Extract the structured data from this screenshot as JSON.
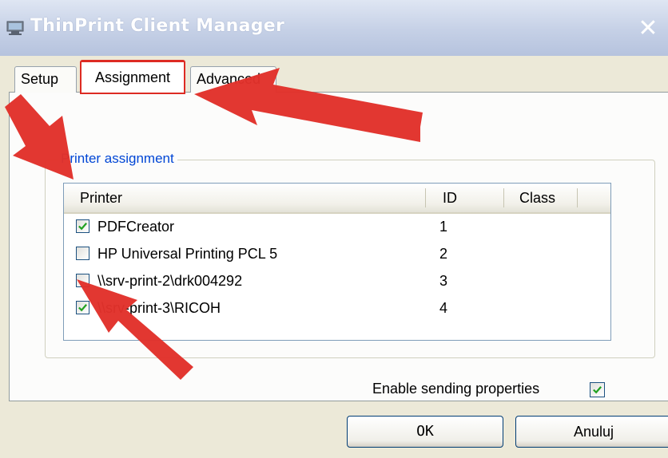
{
  "window": {
    "title": "ThinPrint Client Manager",
    "close_glyph": "✕"
  },
  "tabs": [
    {
      "label": "Setup"
    },
    {
      "label": "Assignment"
    },
    {
      "label": "Advanced"
    }
  ],
  "group": {
    "label": "Printer assignment"
  },
  "list": {
    "columns": [
      "Printer",
      "ID",
      "Class"
    ],
    "rows": [
      {
        "name": "PDFCreator",
        "id": "1",
        "checked": true
      },
      {
        "name": "HP Universal Printing PCL 5",
        "id": "2",
        "checked": false
      },
      {
        "name": "\\\\srv-print-2\\drk004292",
        "id": "3",
        "checked": false
      },
      {
        "name": "\\\\srv-print-3\\RICOH",
        "id": "4",
        "checked": true
      }
    ]
  },
  "options": {
    "enable_sending_properties_label": "Enable sending properties",
    "enable_sending_properties_checked": true
  },
  "buttons": {
    "ok_label": "OK",
    "cancel_label": "Anuluj"
  },
  "colors": {
    "highlight_red": "#dd2b23",
    "group_label_blue": "#0046d5",
    "check_green": "#21a121"
  },
  "icons": {
    "title": "printer-app-icon",
    "annotation": "red-arrow-icon"
  }
}
